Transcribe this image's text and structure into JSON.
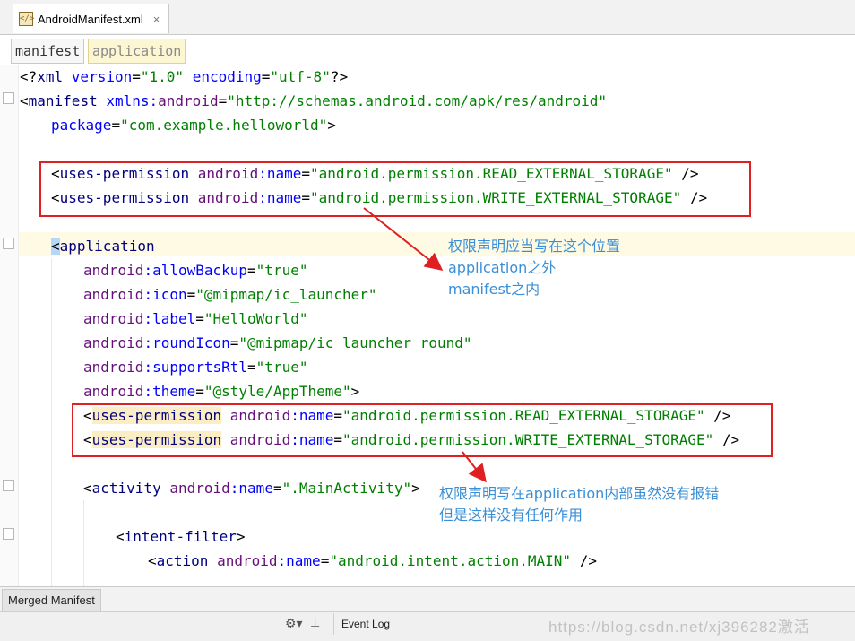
{
  "file_tab": {
    "icon": "xml-file-icon",
    "label": "AndroidManifest.xml",
    "close": "×"
  },
  "breadcrumb": [
    "manifest",
    "application"
  ],
  "code_lines": [
    {
      "indent": 0,
      "parts": [
        [
          "p",
          "<?"
        ],
        [
          "t",
          "xml "
        ],
        [
          "an",
          "version"
        ],
        [
          "p",
          "="
        ],
        [
          "s",
          "\"1.0\""
        ],
        [
          "p",
          " "
        ],
        [
          "an",
          "encoding"
        ],
        [
          "p",
          "="
        ],
        [
          "s",
          "\"utf-8\""
        ],
        [
          "p",
          "?>"
        ]
      ]
    },
    {
      "indent": 0,
      "parts": [
        [
          "p",
          "<"
        ],
        [
          "t",
          "manifest "
        ],
        [
          "an",
          "xmlns:"
        ],
        [
          "a",
          "android"
        ],
        [
          "p",
          "="
        ],
        [
          "s",
          "\"http://schemas.android.com/apk/res/android\""
        ]
      ]
    },
    {
      "indent": 1,
      "parts": [
        [
          "an",
          "package"
        ],
        [
          "p",
          "="
        ],
        [
          "s",
          "\"com.example.helloworld\""
        ],
        [
          "p",
          ">"
        ]
      ]
    },
    {
      "indent": 0,
      "parts": []
    },
    {
      "indent": 1,
      "parts": [
        [
          "p",
          "<"
        ],
        [
          "t",
          "uses-permission "
        ],
        [
          "a",
          "android"
        ],
        [
          "an",
          ":name"
        ],
        [
          "p",
          "="
        ],
        [
          "s",
          "\"android.permission.READ_EXTERNAL_STORAGE\""
        ],
        [
          "p",
          " />"
        ]
      ]
    },
    {
      "indent": 1,
      "parts": [
        [
          "p",
          "<"
        ],
        [
          "t",
          "uses-permission "
        ],
        [
          "a",
          "android"
        ],
        [
          "an",
          ":name"
        ],
        [
          "p",
          "="
        ],
        [
          "s",
          "\"android.permission.WRITE_EXTERNAL_STORAGE\""
        ],
        [
          "p",
          " />"
        ]
      ]
    },
    {
      "indent": 0,
      "parts": []
    },
    {
      "indent": 1,
      "parts": [
        [
          "cursor",
          "<"
        ],
        [
          "t",
          "application"
        ]
      ]
    },
    {
      "indent": 2,
      "parts": [
        [
          "a",
          "android"
        ],
        [
          "an",
          ":allowBackup"
        ],
        [
          "p",
          "="
        ],
        [
          "s",
          "\"true\""
        ]
      ]
    },
    {
      "indent": 2,
      "parts": [
        [
          "a",
          "android"
        ],
        [
          "an",
          ":icon"
        ],
        [
          "p",
          "="
        ],
        [
          "s",
          "\"@mipmap/ic_launcher\""
        ]
      ]
    },
    {
      "indent": 2,
      "parts": [
        [
          "a",
          "android"
        ],
        [
          "an",
          ":label"
        ],
        [
          "p",
          "="
        ],
        [
          "s",
          "\"HelloWorld\""
        ]
      ]
    },
    {
      "indent": 2,
      "parts": [
        [
          "a",
          "android"
        ],
        [
          "an",
          ":roundIcon"
        ],
        [
          "p",
          "="
        ],
        [
          "s",
          "\"@mipmap/ic_launcher_round\""
        ]
      ]
    },
    {
      "indent": 2,
      "parts": [
        [
          "a",
          "android"
        ],
        [
          "an",
          ":supportsRtl"
        ],
        [
          "p",
          "="
        ],
        [
          "s",
          "\"true\""
        ]
      ]
    },
    {
      "indent": 2,
      "parts": [
        [
          "a",
          "android"
        ],
        [
          "an",
          ":theme"
        ],
        [
          "p",
          "="
        ],
        [
          "s",
          "\"@style/AppTheme\""
        ],
        [
          "p",
          ">"
        ]
      ]
    },
    {
      "indent": 2,
      "parts": [
        [
          "p",
          "<"
        ],
        [
          "sel",
          "uses-permission"
        ],
        [
          "p",
          " "
        ],
        [
          "a",
          "android"
        ],
        [
          "an",
          ":name"
        ],
        [
          "p",
          "="
        ],
        [
          "s",
          "\"android.permission.READ_EXTERNAL_STORAGE\""
        ],
        [
          "p",
          " />"
        ]
      ]
    },
    {
      "indent": 2,
      "parts": [
        [
          "p",
          "<"
        ],
        [
          "sel",
          "uses-permission"
        ],
        [
          "p",
          " "
        ],
        [
          "a",
          "android"
        ],
        [
          "an",
          ":name"
        ],
        [
          "p",
          "="
        ],
        [
          "s",
          "\"android.permission.WRITE_EXTERNAL_STORAGE\""
        ],
        [
          "p",
          " />"
        ]
      ]
    },
    {
      "indent": 0,
      "parts": []
    },
    {
      "indent": 2,
      "parts": [
        [
          "p",
          "<"
        ],
        [
          "t",
          "activity "
        ],
        [
          "a",
          "android"
        ],
        [
          "an",
          ":name"
        ],
        [
          "p",
          "="
        ],
        [
          "s",
          "\".MainActivity\""
        ],
        [
          "p",
          ">"
        ]
      ]
    },
    {
      "indent": 0,
      "parts": []
    },
    {
      "indent": 3,
      "parts": [
        [
          "p",
          "<"
        ],
        [
          "t",
          "intent-filter"
        ],
        [
          "p",
          ">"
        ]
      ]
    },
    {
      "indent": 4,
      "parts": [
        [
          "p",
          "<"
        ],
        [
          "t",
          "action "
        ],
        [
          "a",
          "android"
        ],
        [
          "an",
          ":name"
        ],
        [
          "p",
          "="
        ],
        [
          "s",
          "\"android.intent.action.MAIN\""
        ],
        [
          "p",
          " />"
        ]
      ]
    }
  ],
  "annotations": [
    "权限声明应当写在这个位置\napplication之外\nmanifest之内",
    "权限声明写在application内部虽然没有报错\n但是这样没有任何作用"
  ],
  "bottom_tab": "Merged Manifest",
  "status": {
    "event_log": "Event Log",
    "gear_icon": "gear-icon",
    "watermark": "https://blog.csdn.net/xj396282激活"
  },
  "colors": {
    "annotation_box": "#e02020",
    "annotation_text": "#3a8fd6",
    "arrow": "#e02020"
  }
}
